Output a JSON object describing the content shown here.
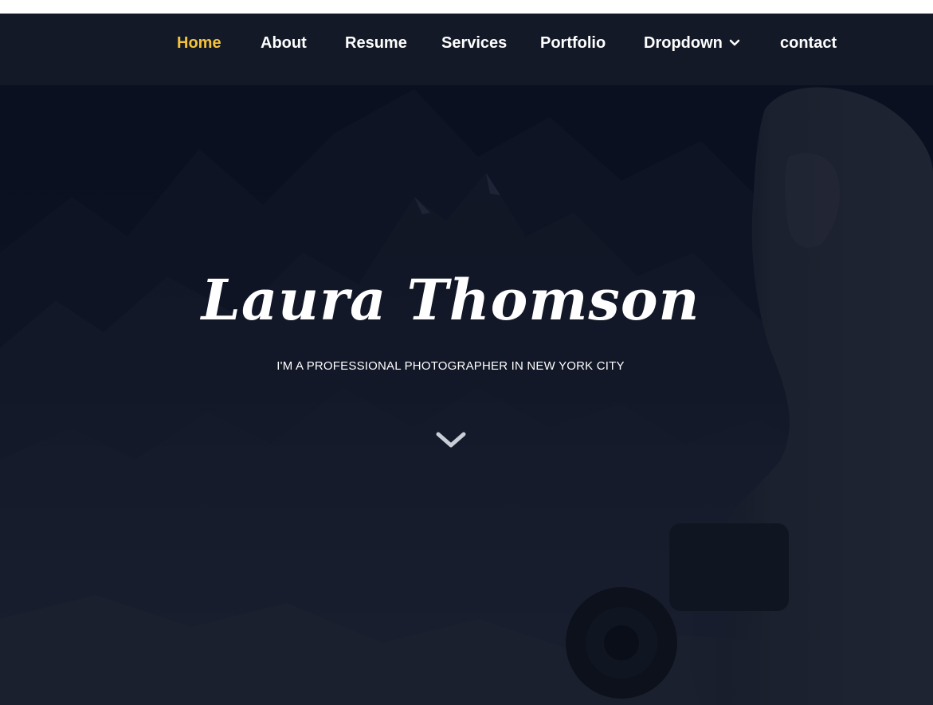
{
  "nav": {
    "items": [
      {
        "label": "Home"
      },
      {
        "label": "About"
      },
      {
        "label": "Resume"
      },
      {
        "label": "Services"
      },
      {
        "label": "Portfolio"
      },
      {
        "label": "Dropdown"
      },
      {
        "label": "contact"
      }
    ],
    "active_index": 0,
    "dropdown_icon": "chevron-down-icon"
  },
  "hero": {
    "name": "Laura Thomson",
    "subtitle": "I'M A PROFESSIONAL PHOTOGRAPHER IN NEW YORK CITY",
    "scroll_icon": "chevron-down-icon"
  },
  "colors": {
    "accent": "#f5c33b",
    "text": "#ffffff",
    "overlay": "#0c1120"
  }
}
